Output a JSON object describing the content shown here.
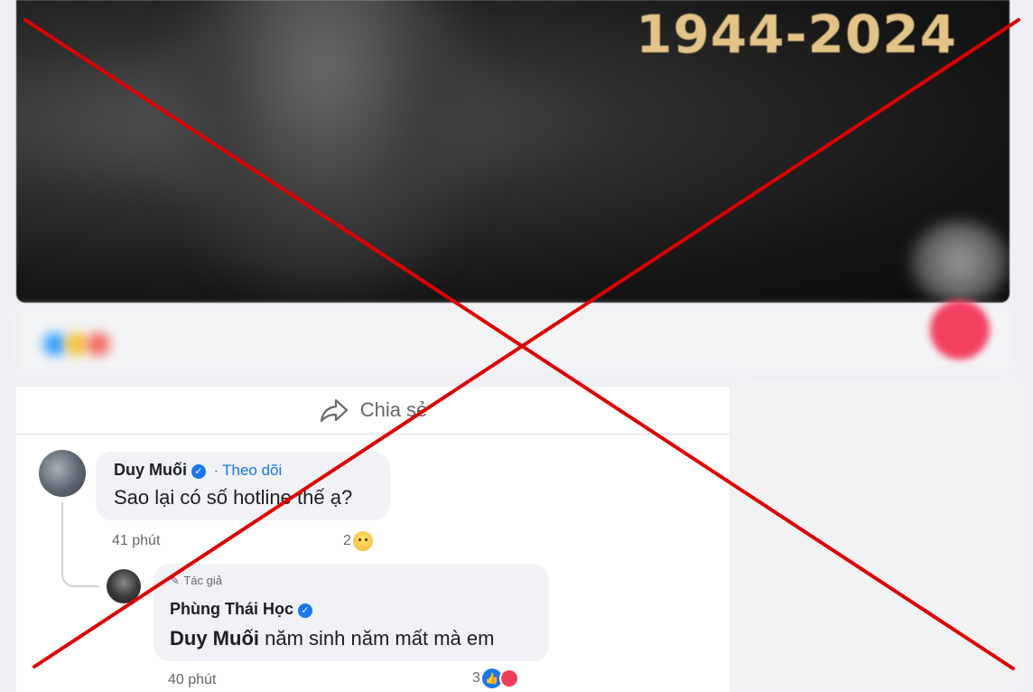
{
  "post": {
    "image_year_text": "1944-2024"
  },
  "actions": {
    "share_label": "Chia sẻ"
  },
  "comments": [
    {
      "author": "Duy Muối",
      "follow_label": "Theo dõi",
      "separator": "·",
      "text": "Sao lại có số hotline thế ạ?",
      "time": "41 phút",
      "reaction_count": "2",
      "reaction_icons": [
        "sad-emoji-icon"
      ]
    },
    {
      "author_tag": "Tác giả",
      "author": "Phùng Thái Học",
      "mention": "Duy Muối",
      "text_rest": " năm sinh năm mất mà em",
      "time": "40 phút",
      "reaction_count": "3",
      "reaction_icons": [
        "like-icon",
        "care-icon"
      ]
    }
  ],
  "overlay": {
    "cross_color": "#e00000"
  },
  "colors": {
    "accent": "#1877f2",
    "year_text": "#e3c486"
  }
}
